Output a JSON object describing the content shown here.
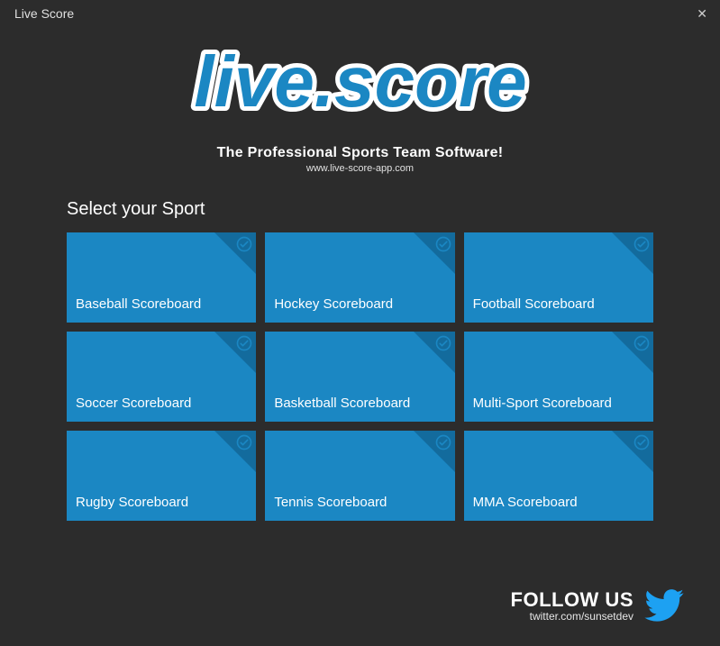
{
  "window": {
    "title": "Live Score"
  },
  "header": {
    "logo_text": "live.score",
    "tagline": "The Professional Sports Team Software!",
    "website": "www.live-score-app.com"
  },
  "brand": {
    "primary": "#1b87c3",
    "primary_dark": "#136b9d",
    "twitter_blue": "#1da1f2"
  },
  "sportSelect": {
    "label": "Select your Sport",
    "tiles": [
      {
        "id": "baseball",
        "label": "Baseball Scoreboard"
      },
      {
        "id": "hockey",
        "label": "Hockey Scoreboard"
      },
      {
        "id": "football",
        "label": "Football Scoreboard"
      },
      {
        "id": "soccer",
        "label": "Soccer Scoreboard"
      },
      {
        "id": "basketball",
        "label": "Basketball Scoreboard"
      },
      {
        "id": "multisport",
        "label": "Multi-Sport Scoreboard"
      },
      {
        "id": "rugby",
        "label": "Rugby Scoreboard"
      },
      {
        "id": "tennis",
        "label": "Tennis Scoreboard"
      },
      {
        "id": "mma",
        "label": "MMA Scoreboard"
      }
    ]
  },
  "follow": {
    "title": "FOLLOW US",
    "handle": "twitter.com/sunsetdev"
  }
}
